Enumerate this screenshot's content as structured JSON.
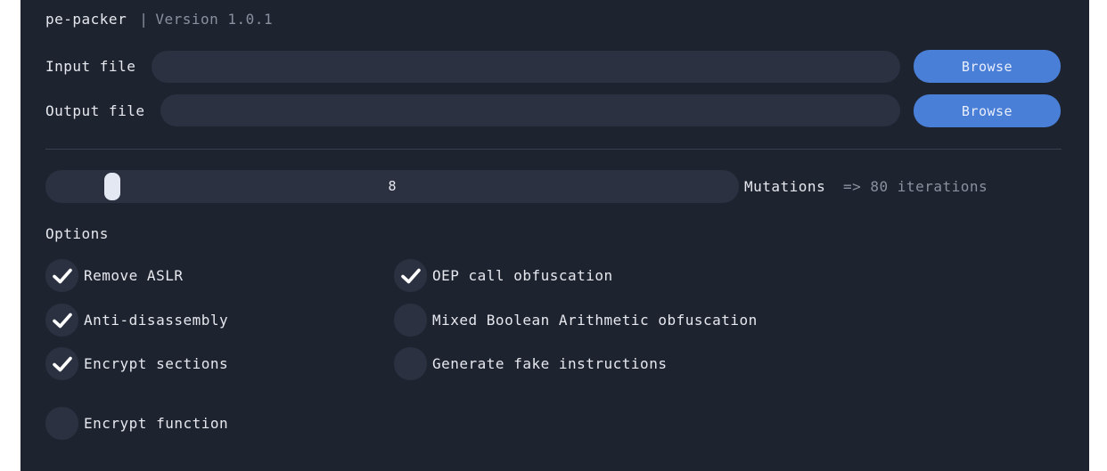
{
  "app": {
    "name": "pe-packer",
    "separator": "|",
    "version": "Version 1.0.1"
  },
  "input": {
    "label": "Input file",
    "value": "",
    "browse_label": "Browse"
  },
  "output": {
    "label": "Output file",
    "value": "",
    "browse_label": "Browse"
  },
  "mutations": {
    "value": "8",
    "level": 0.08,
    "label": "Mutations",
    "iterations_text": "=> 80 iterations"
  },
  "options": {
    "heading": "Options",
    "items": [
      {
        "label": "Remove ASLR",
        "checked": true
      },
      {
        "label": "Anti-disassembly",
        "checked": true
      },
      {
        "label": "Encrypt sections",
        "checked": true
      },
      {
        "label": "Encrypt function",
        "checked": false
      },
      {
        "label": "OEP call obfuscation",
        "checked": true
      },
      {
        "label": "Mixed Boolean Arithmetic obfuscation",
        "checked": false
      },
      {
        "label": "Generate fake instructions",
        "checked": false
      }
    ]
  },
  "colors": {
    "background": "#1e2330",
    "field": "#2b3140",
    "accent": "#4a7fd8",
    "text": "#e6e8ee",
    "muted_text": "#8a909e"
  }
}
